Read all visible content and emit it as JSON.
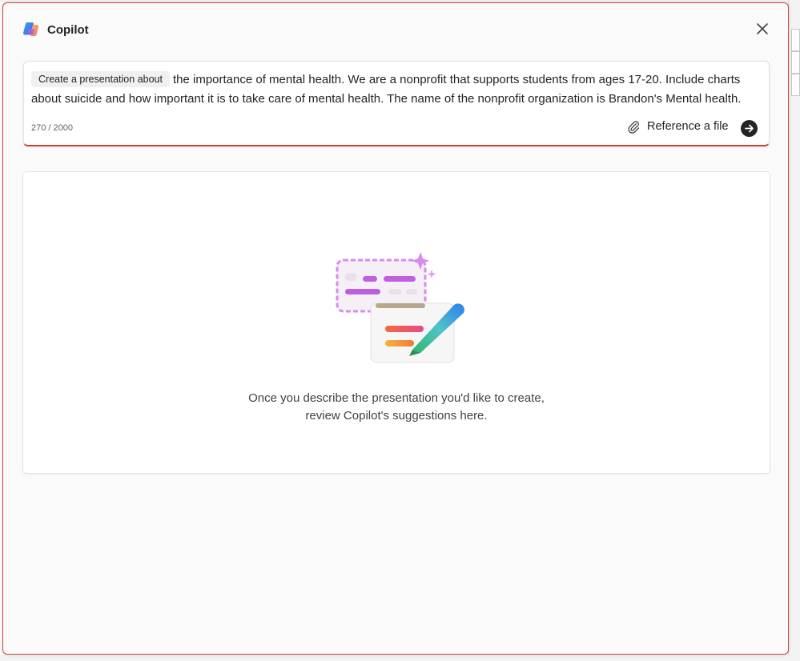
{
  "dialog": {
    "title": "Copilot",
    "close_icon": "close-icon",
    "logo_icon": "copilot-logo"
  },
  "prompt": {
    "chip_label": "Create a presentation about",
    "text": "the importance of mental health. We are a nonprofit that supports students from ages 17-20. Include charts about suicide and how important it is to take care of mental health. The name of the nonprofit organization is Brandon's Mental health.",
    "char_count": "270 / 2000",
    "reference_label": "Reference a file",
    "reference_icon": "paperclip-icon",
    "send_icon": "arrow-right-icon"
  },
  "suggestions": {
    "illustration_icon": "presentation-pen-illustration",
    "empty_line1": "Once you describe the presentation you'd like to create,",
    "empty_line2": "review Copilot's suggestions here."
  },
  "colors": {
    "dialog_border": "#d4473a",
    "prompt_underline": "#c8413a",
    "text": "#242424",
    "send_button": "#242424"
  }
}
